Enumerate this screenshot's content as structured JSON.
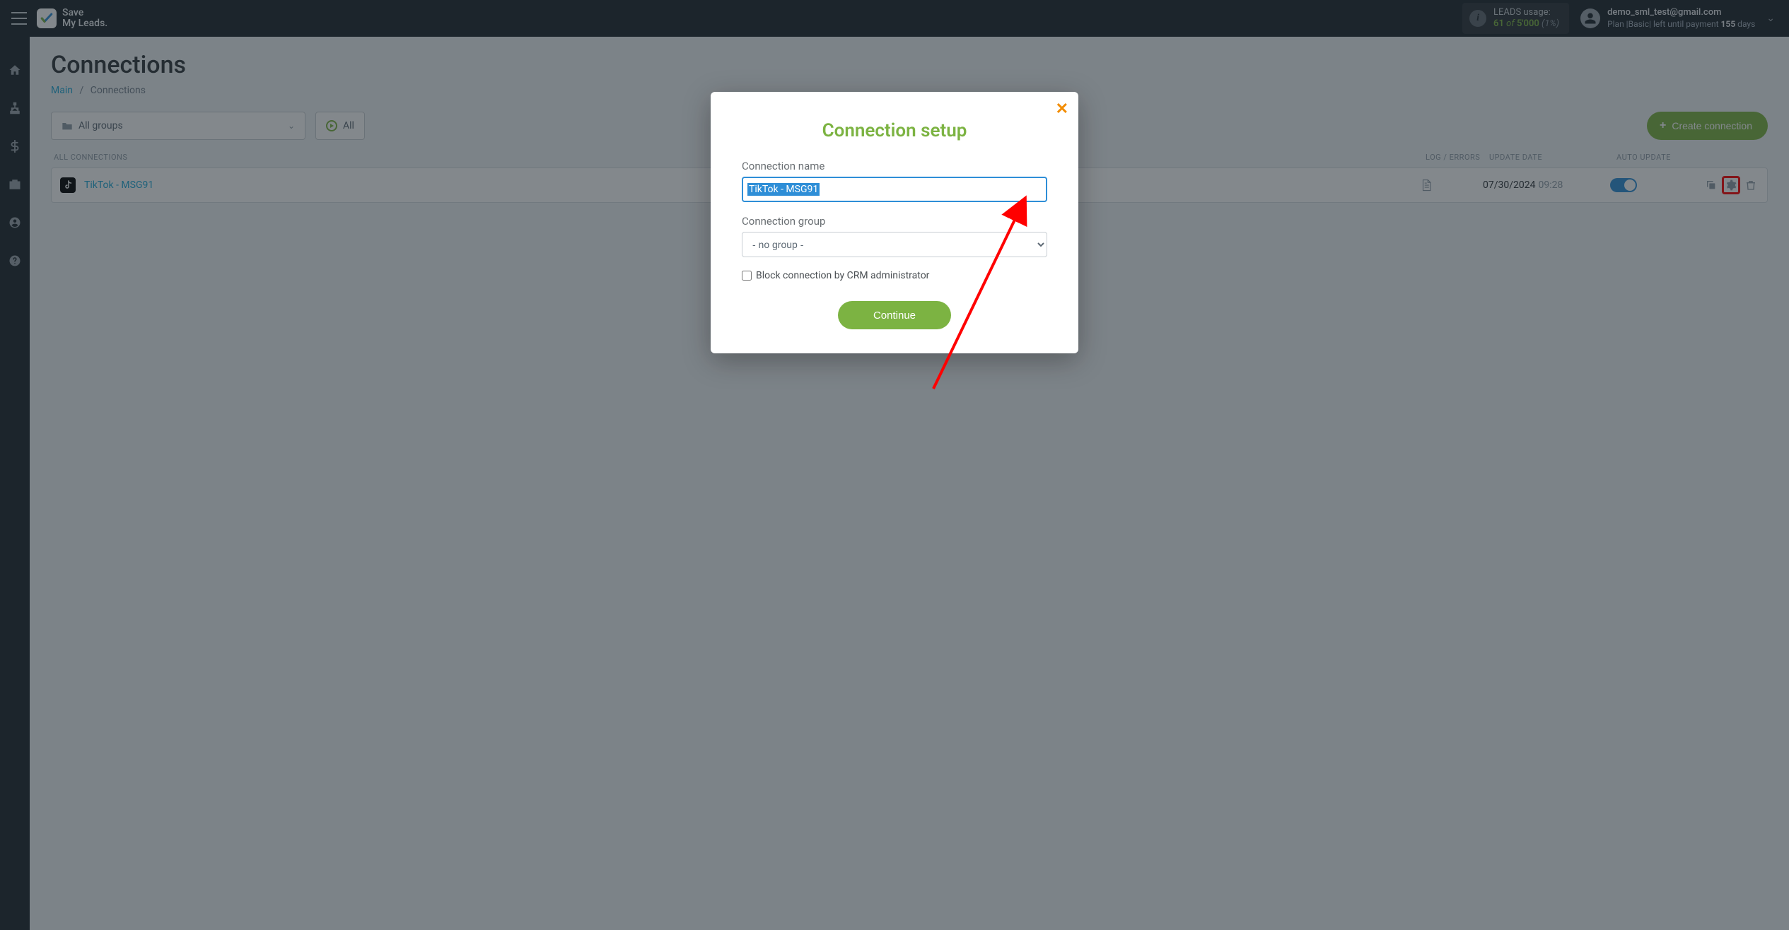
{
  "brand": {
    "line1": "Save",
    "line2": "My Leads."
  },
  "leads_usage": {
    "label": "LEADS usage:",
    "used": "61",
    "of": "of",
    "total": "5'000",
    "pct": "(1%)"
  },
  "user": {
    "email": "demo_sml_test@gmail.com",
    "plan_prefix": "Plan |",
    "plan_name": "Basic",
    "plan_mid": "| left until payment ",
    "days": "155",
    "days_suffix": " days"
  },
  "page": {
    "title": "Connections",
    "breadcrumb_main": "Main",
    "breadcrumb_current": "Connections"
  },
  "filters": {
    "all_groups": "All groups",
    "all_something": "All"
  },
  "create_button": "Create connection",
  "table": {
    "header_all": "ALL CONNECTIONS",
    "header_log": "LOG / ERRORS",
    "header_date": "UPDATE DATE",
    "header_auto": "AUTO UPDATE"
  },
  "row": {
    "name": "TikTok - MSG91",
    "date": "07/30/2024",
    "time": "09:28"
  },
  "modal": {
    "title": "Connection setup",
    "name_label": "Connection name",
    "name_value": "TikTok - MSG91",
    "group_label": "Connection group",
    "group_value": "- no group -",
    "block_label": "Block connection by CRM administrator",
    "continue": "Continue"
  }
}
